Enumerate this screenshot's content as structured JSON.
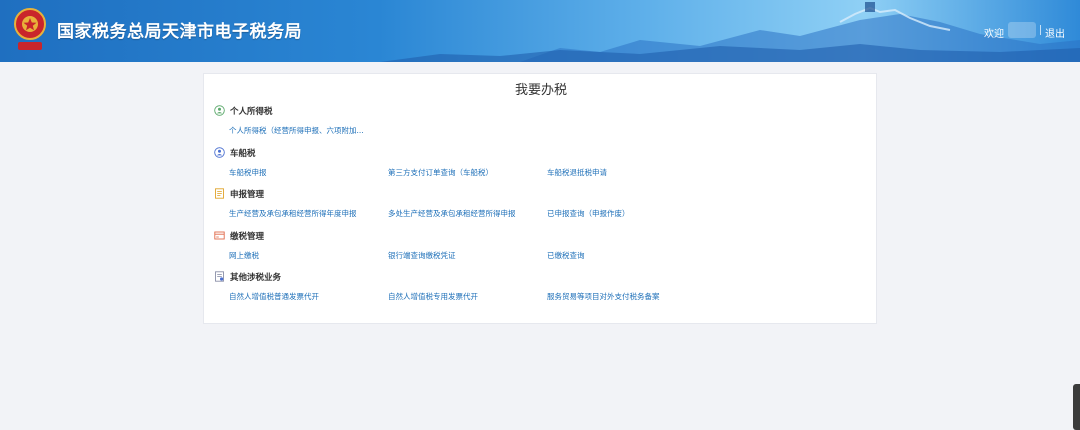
{
  "header": {
    "title": "国家税务总局天津市电子税务局",
    "welcome": "欢迎",
    "logout": "退出",
    "emblem_icon": "tax-emblem-icon",
    "colors": {
      "brand": "#1f6fc0",
      "accent": "#8fd0f5"
    }
  },
  "main": {
    "title": "我要办税",
    "sections": [
      {
        "icon": "person-tax-icon",
        "title": "个人所得税",
        "links": [
          "个人所得税（经营所得申报、六项附加..."
        ]
      },
      {
        "icon": "vehicle-tax-icon",
        "title": "车船税",
        "links": [
          "车船税申报",
          "第三方支付订单查询（车船税）",
          "车船税退抵税申请"
        ]
      },
      {
        "icon": "declaration-icon",
        "title": "申报管理",
        "links": [
          "生产经营及承包承租经营所得年度申报",
          "多处生产经营及承包承租经营所得申报",
          "已申报查询（申报作废）"
        ]
      },
      {
        "icon": "payment-icon",
        "title": "缴税管理",
        "links": [
          "网上缴税",
          "银行端查询缴税凭证",
          "已缴税查询"
        ]
      },
      {
        "icon": "other-business-icon",
        "title": "其他涉税业务",
        "links": [
          "自然人增值税普通发票代开",
          "自然人增值税专用发票代开",
          "服务贸易等项目对外支付税务备案"
        ]
      }
    ],
    "link_color": "#1d6fb8"
  }
}
